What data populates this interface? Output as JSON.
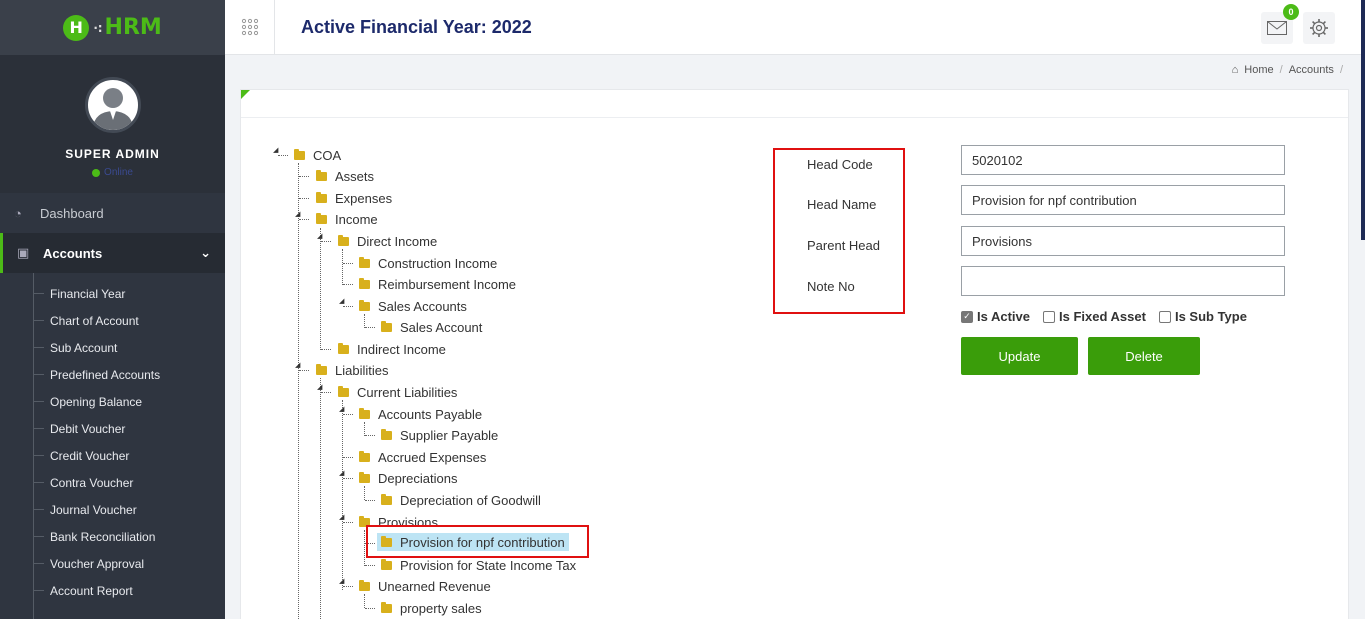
{
  "brand": {
    "logo_letter": "H",
    "logo_text": "HRM"
  },
  "profile": {
    "name": "SUPER ADMIN",
    "status": "Online"
  },
  "nav": {
    "dashboard": "Dashboard",
    "accounts": "Accounts",
    "accounts_sub": [
      "Financial Year",
      "Chart of Account",
      "Sub Account",
      "Predefined Accounts",
      "Opening Balance",
      "Debit Voucher",
      "Credit Voucher",
      "Contra Voucher",
      "Journal Voucher",
      "Bank Reconciliation",
      "Voucher Approval",
      "Account Report"
    ]
  },
  "header": {
    "title": "Active Financial Year: 2022",
    "mail_badge": "0"
  },
  "breadcrumb": {
    "home": "Home",
    "current": "Accounts"
  },
  "tree": [
    "COA",
    "Assets",
    "Expenses",
    "Income",
    "Direct Income",
    "Construction Income",
    "Reimbursement Income",
    "Sales Accounts",
    "Sales Account",
    "Indirect Income",
    "Liabilities",
    "Current Liabilities",
    "Accounts Payable",
    "Supplier Payable",
    "Accrued Expenses",
    "Depreciations",
    "Depreciation of Goodwill",
    "Provisions",
    "Provision for npf contribution",
    "Provision for State Income Tax",
    "Unearned Revenue",
    "property sales"
  ],
  "form": {
    "head_code_label": "Head Code",
    "head_name_label": "Head Name",
    "parent_head_label": "Parent Head",
    "note_no_label": "Note No",
    "head_code": "5020102",
    "head_name": "Provision for npf contribution",
    "parent_head": "Provisions",
    "note_no": "",
    "is_active_label": "Is Active",
    "is_active": true,
    "is_fixed_asset_label": "Is Fixed Asset",
    "is_fixed_asset": false,
    "is_sub_type_label": "Is Sub Type",
    "is_sub_type": false,
    "update_label": "Update",
    "delete_label": "Delete"
  },
  "colors": {
    "accent": "#3a9d0a",
    "sidebar": "#2f3540",
    "heading": "#1d2a6b",
    "highlight": "#e01010"
  }
}
